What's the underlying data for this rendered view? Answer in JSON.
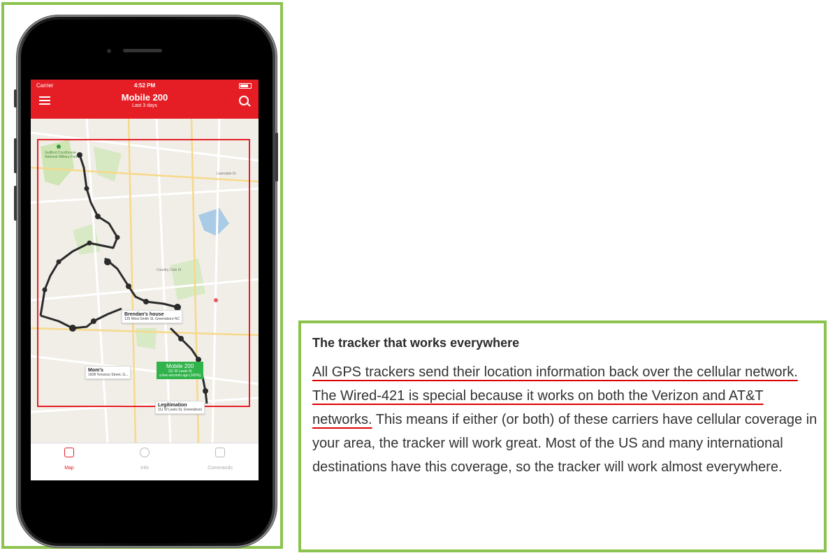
{
  "app": {
    "carrier": "Carrier",
    "time": "4:52 PM",
    "title": "Mobile 200",
    "subtitle": "Last 3 days"
  },
  "map": {
    "park_label": "Guilford Courthouse National Military Park",
    "road_labels": [
      "Lawndale Dr",
      "Country Club Dr"
    ],
    "callouts": [
      {
        "title": "Brendan's house",
        "address": "125 West Smith St, Greensboro NC"
      },
      {
        "title": "Mom's",
        "address": "1608 Terrance Street, G..."
      },
      {
        "title": "Legitimation",
        "address": "111 W Lewis St, Greensboro"
      }
    ],
    "device_callout": {
      "title": "Mobile 200",
      "address": "111 W Lewis St",
      "status": "a few seconds ago (100%)"
    }
  },
  "tabs": [
    {
      "label": "Map",
      "icon": "map-icon",
      "active": true
    },
    {
      "label": "Info",
      "icon": "info-icon",
      "active": false
    },
    {
      "label": "Commands",
      "icon": "commands-icon",
      "active": false
    }
  ],
  "article": {
    "heading": "The tracker that works everywhere",
    "underlined": "All GPS trackers send their location information back over the cellular network. The Wired-421 is special because it works on both the Verizon and AT&T networks.",
    "rest": " This means if either (or both) of these carriers have cellular coverage in your area, the tracker will work great. Most of the US and many international destinations have this coverage, so the tracker will work almost everywhere."
  },
  "colors": {
    "frame_green": "#8cc34f",
    "app_red": "#e51e25",
    "device_green": "#2fb34a",
    "underline_red": "#e00000"
  }
}
